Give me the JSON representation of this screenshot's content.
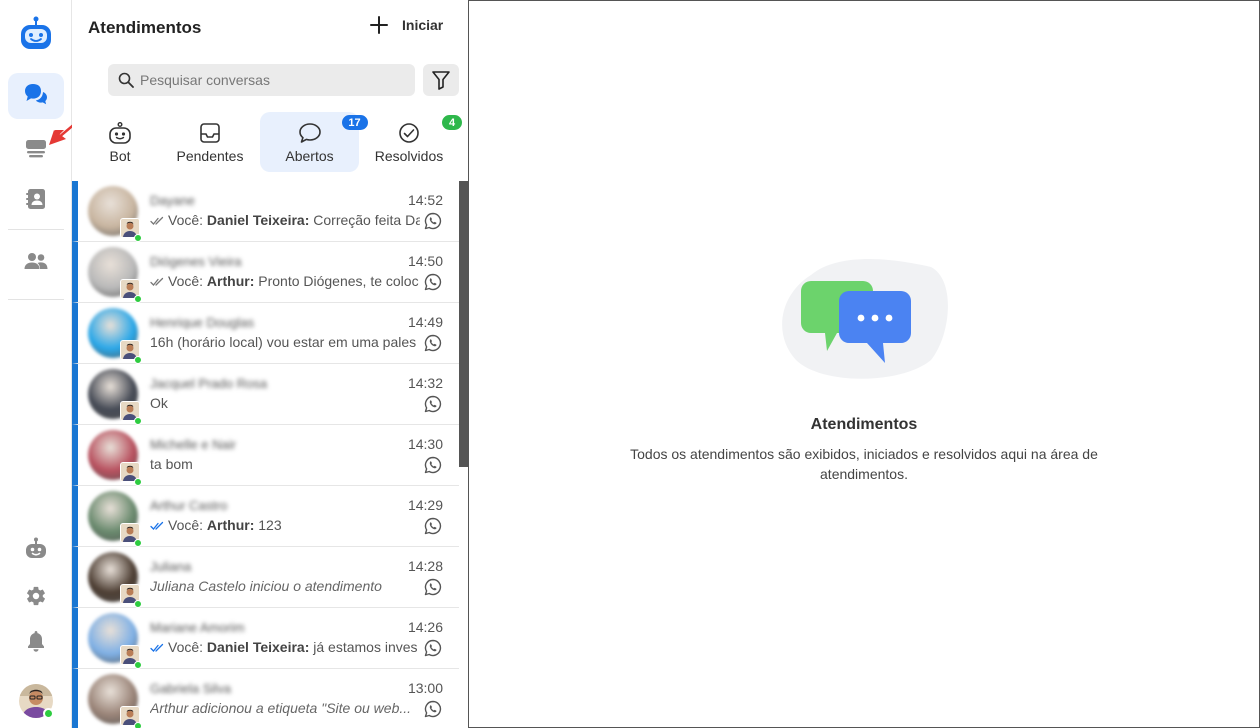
{
  "sidebar": {
    "items": [
      "logo-bot-icon",
      "chat-icon",
      "inbox-stack-icon",
      "contacts-icon",
      "team-icon",
      "bot-icon",
      "gear-icon",
      "bell-icon",
      "user-avatar"
    ],
    "accent_color": "#1a73e8"
  },
  "panel": {
    "title": "Atendimentos",
    "start_label": "Iniciar",
    "search_placeholder": "Pesquisar conversas"
  },
  "tabs": [
    {
      "label": "Bot",
      "icon": "bot-icon",
      "badge": ""
    },
    {
      "label": "Pendentes",
      "icon": "inbox-icon",
      "badge": ""
    },
    {
      "label": "Abertos",
      "icon": "chat-bubble-icon",
      "badge": "17",
      "badge_color": "#1a73e8"
    },
    {
      "label": "Resolvidos",
      "icon": "check-circle-icon",
      "badge": "4",
      "badge_color": "#2eb84b"
    }
  ],
  "conversations": [
    {
      "name": "Dayane",
      "time": "14:52",
      "prefix": "Você:",
      "author": "Daniel Teixeira:",
      "text": "Correção feita Da",
      "check": "gray",
      "avatar": "#c8b5a0"
    },
    {
      "name": "Diógenes Vieira",
      "time": "14:50",
      "prefix": "Você:",
      "author": "Arthur:",
      "text": "Pronto Diógenes, te coloc",
      "check": "gray",
      "avatar": "#b9b9b9"
    },
    {
      "name": "Henrique Douglas",
      "time": "14:49",
      "prefix": "",
      "author": "",
      "text": "16h (horário local) vou estar em uma pales",
      "check": "",
      "avatar": "#2aa7e8"
    },
    {
      "name": "Jacquel Prado Rosa",
      "time": "14:32",
      "prefix": "",
      "author": "",
      "text": "Ok",
      "check": "",
      "avatar": "#454a55"
    },
    {
      "name": "Michelle e Nair",
      "time": "14:30",
      "prefix": "",
      "author": "",
      "text": "ta bom",
      "check": "",
      "avatar": "#b8515f"
    },
    {
      "name": "Arthur Castro",
      "time": "14:29",
      "prefix": "Você:",
      "author": "Arthur:",
      "text": "123",
      "check": "blue",
      "avatar": "#6a8a6e"
    },
    {
      "name": "Juliana",
      "time": "14:28",
      "prefix": "",
      "author": "",
      "text": "Juliana Castelo iniciou o atendimento",
      "check": "",
      "italic": true,
      "avatar": "#4d3e33"
    },
    {
      "name": "Mariane Amorim",
      "time": "14:26",
      "prefix": "Você:",
      "author": "Daniel Teixeira:",
      "text": "já estamos inves",
      "check": "blue",
      "avatar": "#7fb0e5"
    },
    {
      "name": "Gabriela Silva",
      "time": "13:00",
      "prefix": "",
      "author": "",
      "text": "Arthur adicionou a etiqueta \"Site ou web...",
      "check": "",
      "italic": true,
      "avatar": "#9a8478"
    }
  ],
  "empty_state": {
    "title": "Atendimentos",
    "description": "Todos os atendimentos são exibidos, iniciados e resolvidos aqui na área de atendimentos."
  }
}
